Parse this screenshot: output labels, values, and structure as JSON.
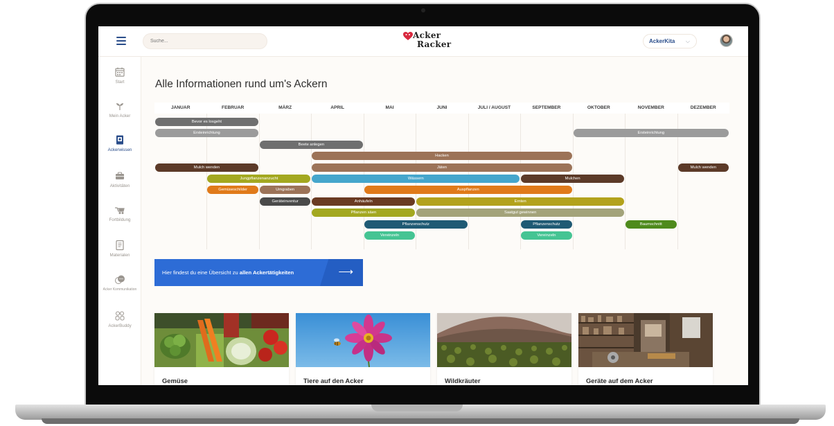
{
  "header": {
    "search_placeholder": "Suche...",
    "logo_line1": "Acker",
    "logo_line2": "Racker",
    "user": "AckerKita",
    "user_chevron": "⌵"
  },
  "sidebar": {
    "items": [
      {
        "label": "Start",
        "icon": "calendar-icon"
      },
      {
        "label": "Mein Acker",
        "icon": "sprout-icon"
      },
      {
        "label": "Ackerwissen",
        "icon": "book-icon",
        "active": true
      },
      {
        "label": "Aktivitäten",
        "icon": "toolbox-icon"
      },
      {
        "label": "Fortbildung",
        "icon": "wheelbarrow-icon"
      },
      {
        "label": "Materialen",
        "icon": "document-icon"
      },
      {
        "label": "Acker Kommunikation",
        "icon": "chat-icon"
      },
      {
        "label": "AckerBuddy",
        "icon": "group-icon"
      }
    ]
  },
  "main": {
    "title": "Alle Informationen rund um's Ackern",
    "months": [
      "JANUAR",
      "FEBRUAR",
      "MÄRZ",
      "APRIL",
      "MAI",
      "JUNI",
      "JULI / AUGUST",
      "SEPTEMBER",
      "OKTOBER",
      "NOVEMBER",
      "DEZEMBER"
    ],
    "activities": [
      {
        "label": "Bevor es losgeht",
        "start": 0,
        "end": 2,
        "row": 0,
        "color": "#6f6f6f"
      },
      {
        "label": "Ersteinrichtung",
        "start": 0,
        "end": 2,
        "row": 1,
        "color": "#9b9b9b"
      },
      {
        "label": "Ersteinrichtung",
        "start": 8,
        "end": 11,
        "row": 1,
        "color": "#9b9b9b"
      },
      {
        "label": "Beete anlegen",
        "start": 2,
        "end": 4,
        "row": 2,
        "color": "#6f6f6f"
      },
      {
        "label": "Hacken",
        "start": 3,
        "end": 8,
        "row": 3,
        "color": "#9c7358"
      },
      {
        "label": "Mulch wenden",
        "start": 0,
        "end": 2,
        "row": 4,
        "color": "#5c3a28"
      },
      {
        "label": "Jäten",
        "start": 3,
        "end": 8,
        "row": 4,
        "color": "#9c7358"
      },
      {
        "label": "Mulch wenden",
        "start": 10,
        "end": 11,
        "row": 4,
        "color": "#5c3a28"
      },
      {
        "label": "Jungpflanzenanzucht",
        "start": 1,
        "end": 3,
        "row": 5,
        "color": "#a3a820"
      },
      {
        "label": "Wässern",
        "start": 3,
        "end": 7,
        "row": 5,
        "color": "#45a6cc"
      },
      {
        "label": "Mulchen",
        "start": 7,
        "end": 9,
        "row": 5,
        "color": "#5c3a28"
      },
      {
        "label": "Gemüseschilder",
        "start": 1,
        "end": 2,
        "row": 6,
        "color": "#e07a1a"
      },
      {
        "label": "Umgraben",
        "start": 2,
        "end": 3,
        "row": 6,
        "color": "#9c7358"
      },
      {
        "label": "Auspflanzen",
        "start": 4,
        "end": 8,
        "row": 6,
        "color": "#e07a1a"
      },
      {
        "label": "Geräteinventur",
        "start": 2,
        "end": 3,
        "row": 7,
        "color": "#4a4a4a"
      },
      {
        "label": "Anhäufeln",
        "start": 3,
        "end": 5,
        "row": 7,
        "color": "#6a3a22"
      },
      {
        "label": "Ernten",
        "start": 5,
        "end": 9,
        "row": 7,
        "color": "#b3a21c"
      },
      {
        "label": "Pflanzen säen",
        "start": 3,
        "end": 5,
        "row": 8,
        "color": "#a3a820"
      },
      {
        "label": "Saatgut gewinnen",
        "start": 5,
        "end": 9,
        "row": 8,
        "color": "#a3a37a"
      },
      {
        "label": "Pflanzenschutz",
        "start": 4,
        "end": 6,
        "row": 9,
        "color": "#1f5a74"
      },
      {
        "label": "Pflanzenschutz",
        "start": 7,
        "end": 8,
        "row": 9,
        "color": "#1f5a74"
      },
      {
        "label": "Baumschnitt",
        "start": 9,
        "end": 10,
        "row": 9,
        "color": "#4e8a1c"
      },
      {
        "label": "Vereinzeln",
        "start": 4,
        "end": 5,
        "row": 10,
        "color": "#45c493"
      },
      {
        "label": "Vereinzeln",
        "start": 7,
        "end": 8,
        "row": 10,
        "color": "#45c493"
      }
    ],
    "cta": {
      "text": "Hier findest du eine Übersicht zu ",
      "bold": "allen Ackertätigkeiten",
      "arrow": "⟶"
    },
    "cards": [
      {
        "title": "Gemüse",
        "image": "vegetables-photo"
      },
      {
        "title": "Tiere auf den Acker",
        "image": "bee-flower-photo"
      },
      {
        "title": "Wildkräuter",
        "image": "field-photo"
      },
      {
        "title": "Geräte auf dem Acker",
        "image": "tool-shed-photo"
      }
    ]
  }
}
